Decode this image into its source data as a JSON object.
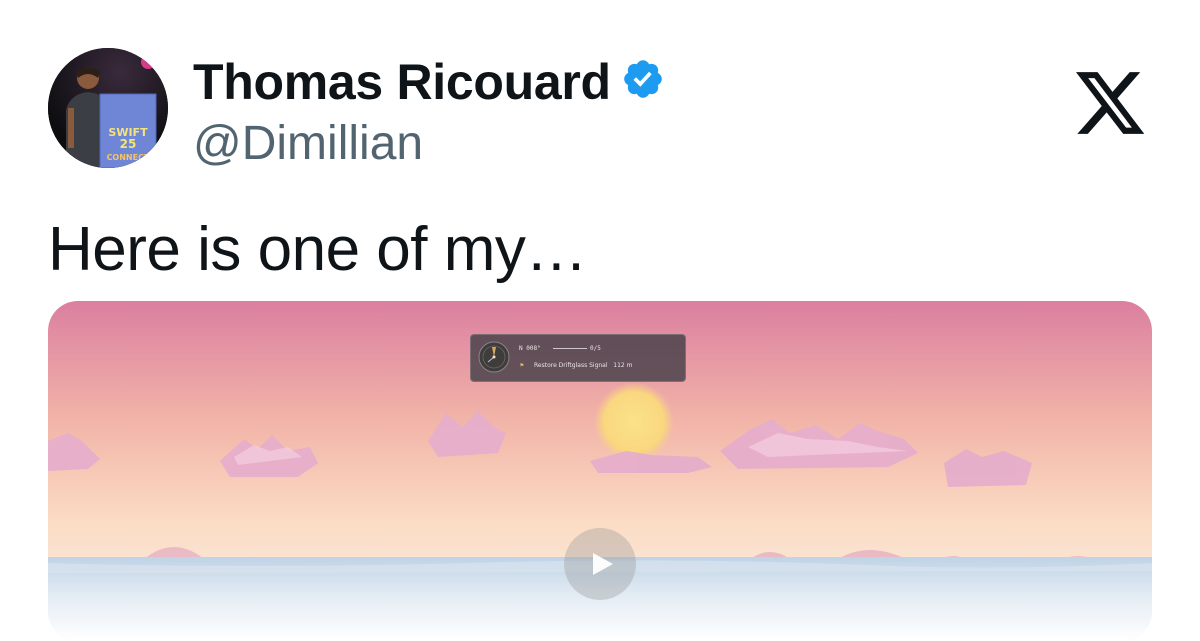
{
  "author": {
    "name": "Thomas Ricouard",
    "handle": "@Dimillian",
    "verified": true,
    "verified_color": "#1d9bf0"
  },
  "avatar": {
    "sign_lines": [
      "SWIFT",
      "25",
      "CONNECT"
    ]
  },
  "brand": {
    "icon": "x-logo-icon"
  },
  "tweet": {
    "text": "Here is one of my…"
  },
  "media": {
    "kind": "video",
    "hud": {
      "heading": "N 008°",
      "progress": "0/5",
      "objective": "Restore Driftglass Signal",
      "distance": "112 m"
    },
    "play_icon": "play-icon"
  }
}
